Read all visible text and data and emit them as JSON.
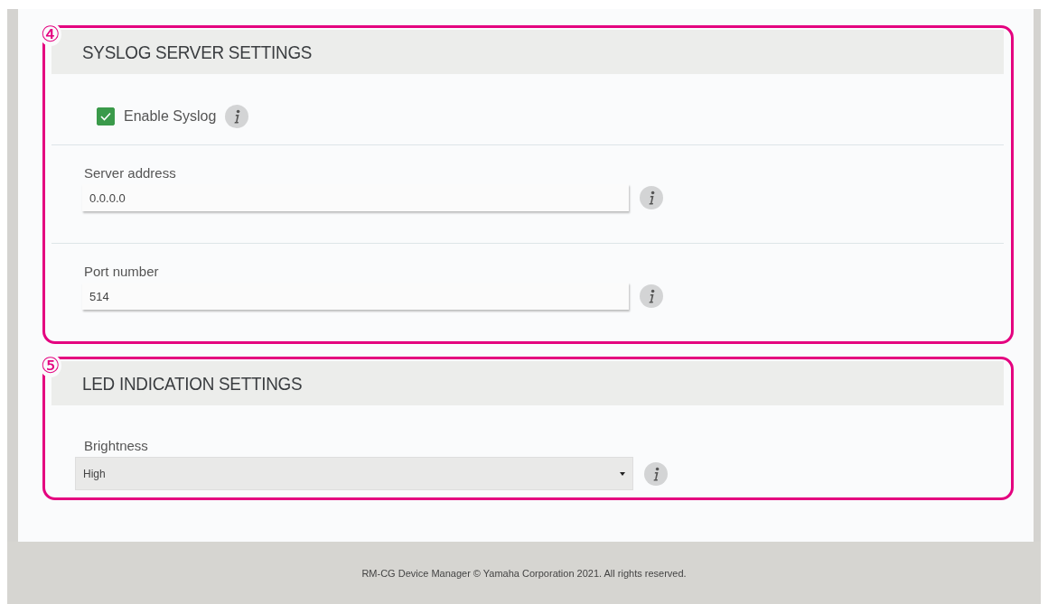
{
  "sections": [
    {
      "marker": "④",
      "title": "SYSLOG SERVER SETTINGS",
      "fields": [
        {
          "kind": "checkbox",
          "label": "Enable Syslog",
          "checked": true
        },
        {
          "kind": "text",
          "label": "Server address",
          "value": "0.0.0.0"
        },
        {
          "kind": "text",
          "label": "Port number",
          "value": "514"
        }
      ]
    },
    {
      "marker": "⑤",
      "title": "LED INDICATION SETTINGS",
      "fields": [
        {
          "kind": "select",
          "label": "Brightness",
          "value": "High"
        }
      ]
    }
  ],
  "footer": "RM-CG Device Manager © Yamaha Corporation 2021. All rights reserved."
}
